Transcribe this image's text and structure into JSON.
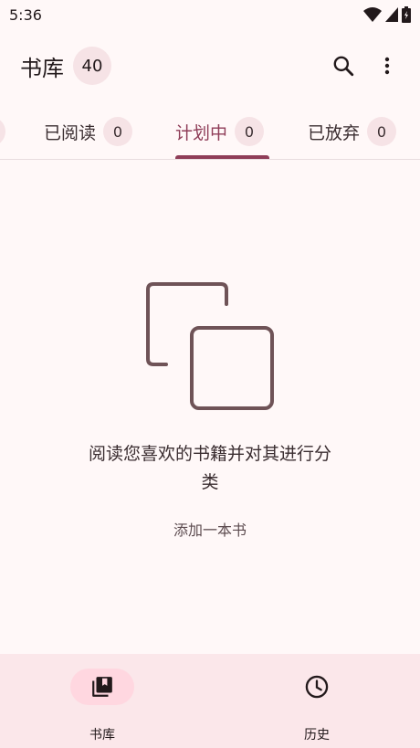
{
  "status_bar": {
    "time": "5:36",
    "icons": [
      "wifi-icon",
      "signal-icon",
      "battery-icon"
    ]
  },
  "app_bar": {
    "title": "书库",
    "count": "40",
    "actions": [
      "search-icon",
      "more-vert-icon"
    ]
  },
  "tabs": [
    {
      "label": "已阅读",
      "count": "0",
      "active": false
    },
    {
      "label": "计划中",
      "count": "0",
      "active": true
    },
    {
      "label": "已放弃",
      "count": "0",
      "active": false
    }
  ],
  "empty_state": {
    "icon": "copy-icon",
    "message": "阅读您喜欢的书籍并对其进行分类",
    "action_label": "添加一本书"
  },
  "bottom_nav": [
    {
      "label": "书库",
      "icon": "library-books-icon",
      "active": true
    },
    {
      "label": "历史",
      "icon": "history-clock-icon",
      "active": false
    }
  ],
  "colors": {
    "accent": "#8f3d58",
    "background": "#fff8f8",
    "badge": "#f6e3e6",
    "nav_background": "#fbe7ea",
    "nav_pill": "#ffd7e0",
    "icon": "#6f5357"
  }
}
